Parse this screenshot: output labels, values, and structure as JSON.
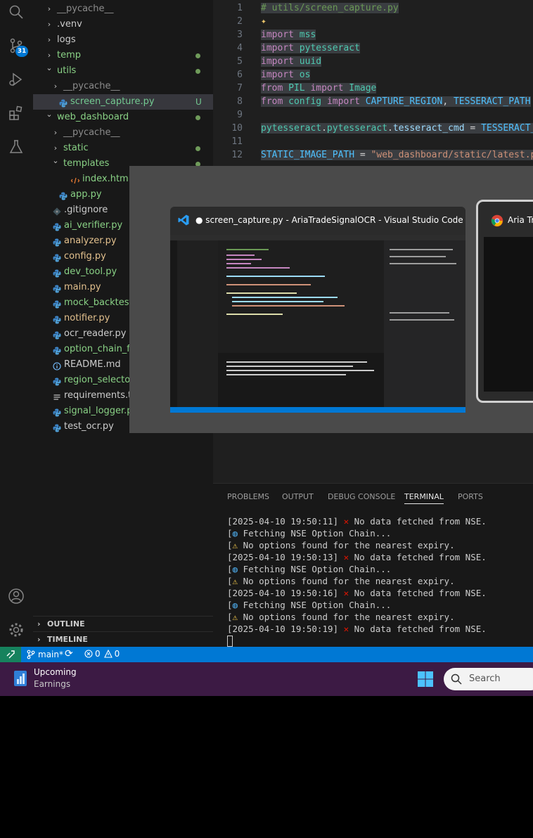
{
  "activity_bar": {
    "source_control_badge": "31"
  },
  "explorer": {
    "items": [
      {
        "label": "__pycache__",
        "indent": 1,
        "chevron": "right",
        "color": "gray"
      },
      {
        "label": ".venv",
        "indent": 1,
        "chevron": "right",
        "color": "white"
      },
      {
        "label": "logs",
        "indent": 1,
        "chevron": "right",
        "color": "white"
      },
      {
        "label": "temp",
        "indent": 1,
        "chevron": "right",
        "color": "green",
        "dot": true
      },
      {
        "label": "utils",
        "indent": 1,
        "chevron": "down",
        "color": "green",
        "dot": true
      },
      {
        "label": "__pycache__",
        "indent": 2,
        "chevron": "right",
        "color": "gray"
      },
      {
        "label": "screen_capture.py",
        "indent": 2,
        "icon": "python",
        "color": "untracked",
        "status": "U",
        "selected": true
      },
      {
        "label": "web_dashboard",
        "indent": 1,
        "chevron": "down",
        "color": "green",
        "dot": true
      },
      {
        "label": "__pycache__",
        "indent": 2,
        "chevron": "right",
        "color": "gray"
      },
      {
        "label": "static",
        "indent": 2,
        "chevron": "right",
        "color": "green",
        "dot": true
      },
      {
        "label": "templates",
        "indent": 2,
        "chevron": "down",
        "color": "green",
        "dot": true
      },
      {
        "label": "index.html",
        "indent": 3,
        "icon": "html",
        "color": "green"
      },
      {
        "label": "app.py",
        "indent": 2,
        "icon": "python",
        "color": "green"
      },
      {
        "label": ".gitignore",
        "indent": 1,
        "icon": "gitignore",
        "color": "white"
      },
      {
        "label": "ai_verifier.py",
        "indent": 1,
        "icon": "python",
        "color": "green"
      },
      {
        "label": "analyzer.py",
        "indent": 1,
        "icon": "python",
        "color": "mod"
      },
      {
        "label": "config.py",
        "indent": 1,
        "icon": "python",
        "color": "mod"
      },
      {
        "label": "dev_tool.py",
        "indent": 1,
        "icon": "python",
        "color": "green"
      },
      {
        "label": "main.py",
        "indent": 1,
        "icon": "python",
        "color": "mod"
      },
      {
        "label": "mock_backtest.py",
        "indent": 1,
        "icon": "python",
        "color": "green"
      },
      {
        "label": "notifier.py",
        "indent": 1,
        "icon": "python",
        "color": "mod"
      },
      {
        "label": "ocr_reader.py",
        "indent": 1,
        "icon": "python",
        "color": "white"
      },
      {
        "label": "option_chain_fetch",
        "indent": 1,
        "icon": "python",
        "color": "green"
      },
      {
        "label": "README.md",
        "indent": 1,
        "icon": "info",
        "color": "white"
      },
      {
        "label": "region_selector.py",
        "indent": 1,
        "icon": "python",
        "color": "green"
      },
      {
        "label": "requirements.txt",
        "indent": 1,
        "icon": "text",
        "color": "white"
      },
      {
        "label": "signal_logger.py",
        "indent": 1,
        "icon": "python",
        "color": "green"
      },
      {
        "label": "test_ocr.py",
        "indent": 1,
        "icon": "python",
        "color": "white"
      }
    ],
    "outline_label": "OUTLINE",
    "timeline_label": "TIMELINE"
  },
  "editor": {
    "lines": [
      {
        "n": "1",
        "tokens": [
          {
            "t": "# utils/screen_capture.py",
            "c": "cmt"
          }
        ]
      },
      {
        "n": "2",
        "tokens": [
          {
            "t": "✦",
            "c": "sparkle"
          }
        ]
      },
      {
        "n": "3",
        "tokens": [
          {
            "t": "import",
            "c": "kw"
          },
          {
            "t": " ",
            "c": "plain"
          },
          {
            "t": "mss",
            "c": "mod"
          }
        ]
      },
      {
        "n": "4",
        "tokens": [
          {
            "t": "import",
            "c": "kw"
          },
          {
            "t": " ",
            "c": "plain"
          },
          {
            "t": "pytesseract",
            "c": "mod"
          }
        ]
      },
      {
        "n": "5",
        "tokens": [
          {
            "t": "import",
            "c": "kw"
          },
          {
            "t": " ",
            "c": "plain"
          },
          {
            "t": "uuid",
            "c": "mod"
          }
        ]
      },
      {
        "n": "6",
        "tokens": [
          {
            "t": "import",
            "c": "kw"
          },
          {
            "t": " ",
            "c": "plain"
          },
          {
            "t": "os",
            "c": "mod"
          }
        ]
      },
      {
        "n": "7",
        "tokens": [
          {
            "t": "from",
            "c": "kw"
          },
          {
            "t": " ",
            "c": "plain"
          },
          {
            "t": "PIL",
            "c": "mod"
          },
          {
            "t": " ",
            "c": "plain"
          },
          {
            "t": "import",
            "c": "kw"
          },
          {
            "t": " ",
            "c": "plain"
          },
          {
            "t": "Image",
            "c": "mod"
          }
        ]
      },
      {
        "n": "8",
        "tokens": [
          {
            "t": "from",
            "c": "kw"
          },
          {
            "t": " ",
            "c": "plain"
          },
          {
            "t": "config",
            "c": "mod"
          },
          {
            "t": " ",
            "c": "plain"
          },
          {
            "t": "import",
            "c": "kw"
          },
          {
            "t": " ",
            "c": "plain"
          },
          {
            "t": "CAPTURE_REGION",
            "c": "const"
          },
          {
            "t": ", ",
            "c": "plain"
          },
          {
            "t": "TESSERACT_PATH",
            "c": "const"
          }
        ]
      },
      {
        "n": "9",
        "tokens": []
      },
      {
        "n": "10",
        "tokens": [
          {
            "t": "pytesseract",
            "c": "mod"
          },
          {
            "t": ".",
            "c": "plain"
          },
          {
            "t": "pytesseract",
            "c": "mod"
          },
          {
            "t": ".",
            "c": "plain"
          },
          {
            "t": "tesseract_cmd",
            "c": "var"
          },
          {
            "t": " = ",
            "c": "plain"
          },
          {
            "t": "TESSERACT_P",
            "c": "const"
          }
        ]
      },
      {
        "n": "11",
        "tokens": []
      },
      {
        "n": "12",
        "tokens": [
          {
            "t": "STATIC_IMAGE_PATH",
            "c": "const"
          },
          {
            "t": " = ",
            "c": "plain"
          },
          {
            "t": "\"web_dashboard/static/latest.pn",
            "c": "str"
          }
        ]
      }
    ]
  },
  "alt_tab": {
    "window1_title": "● screen_capture.py - AriaTradeSignalOCR - Visual Studio Code",
    "window2_title": "Aria Tr"
  },
  "panel": {
    "tabs": [
      "PROBLEMS",
      "OUTPUT",
      "DEBUG CONSOLE",
      "TERMINAL",
      "PORTS"
    ],
    "active_tab": "TERMINAL",
    "terminal_lines": [
      {
        "pre": "[2025-04-10 19:50:11] ",
        "icon": "cross",
        "text": " No data fetched from NSE."
      },
      {
        "pre": "[",
        "icon": "globe",
        "text": " Fetching NSE Option Chain..."
      },
      {
        "pre": "[",
        "icon": "warning",
        "text": " No options found for the nearest expiry."
      },
      {
        "pre": "[2025-04-10 19:50:13] ",
        "icon": "cross",
        "text": " No data fetched from NSE."
      },
      {
        "pre": "[",
        "icon": "globe",
        "text": " Fetching NSE Option Chain..."
      },
      {
        "pre": "[",
        "icon": "warning",
        "text": " No options found for the nearest expiry."
      },
      {
        "pre": "[2025-04-10 19:50:16] ",
        "icon": "cross",
        "text": " No data fetched from NSE."
      },
      {
        "pre": "[",
        "icon": "globe",
        "text": " Fetching NSE Option Chain..."
      },
      {
        "pre": "[",
        "icon": "warning",
        "text": " No options found for the nearest expiry."
      },
      {
        "pre": "[2025-04-10 19:50:19] ",
        "icon": "cross",
        "text": " No data fetched from NSE."
      }
    ]
  },
  "status_bar": {
    "branch": "main*",
    "errors": "0",
    "warnings": "0"
  },
  "taskbar": {
    "widget_title": "Upcoming",
    "widget_subtitle": "Earnings",
    "search_placeholder": "Search"
  }
}
